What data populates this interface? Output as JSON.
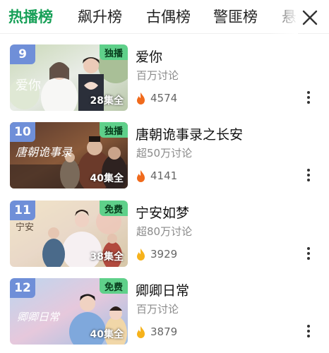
{
  "tabs": [
    {
      "label": "热播榜",
      "active": true
    },
    {
      "label": "飙升榜",
      "active": false
    },
    {
      "label": "古偶榜",
      "active": false
    },
    {
      "label": "警匪榜",
      "active": false
    },
    {
      "label": "悬",
      "active": false
    }
  ],
  "colors": {
    "accent": "#18a058",
    "badge": "#5fd08a",
    "flame_hot": "#f06a1c",
    "flame_warm": "#f6b21b"
  },
  "items": [
    {
      "rank": "9",
      "badge": "独播",
      "episodes": "28集全",
      "title": "爱你",
      "desc": "百万讨论",
      "heat": "4574",
      "flame": "hot",
      "rank_color": "#6f8fd8"
    },
    {
      "rank": "10",
      "badge": "独播",
      "episodes": "40集全",
      "title": "唐朝诡事录之长安",
      "desc": "超50万讨论",
      "heat": "4141",
      "flame": "hot",
      "rank_color": "#6f8fd8"
    },
    {
      "rank": "11",
      "badge": "免费",
      "episodes": "38集全",
      "title": "宁安如梦",
      "desc": "超80万讨论",
      "heat": "3929",
      "flame": "warm",
      "rank_color": "#6f8fd8"
    },
    {
      "rank": "12",
      "badge": "免费",
      "episodes": "40集全",
      "title": "卿卿日常",
      "desc": "百万讨论",
      "heat": "3879",
      "flame": "warm",
      "rank_color": "#6f8fd8"
    }
  ]
}
